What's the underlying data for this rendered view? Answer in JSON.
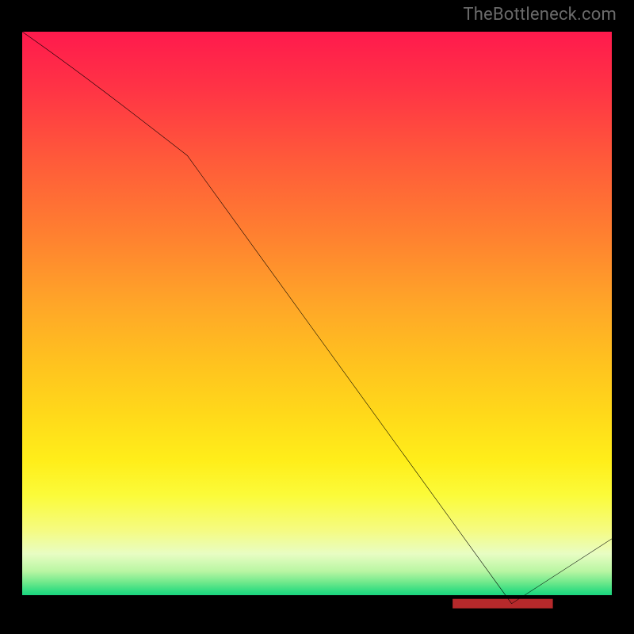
{
  "watermark": "TheBottleneck.com",
  "chart_data": {
    "type": "line",
    "title": "",
    "xlabel": "",
    "ylabel": "",
    "xlim": [
      0,
      100
    ],
    "ylim": [
      0,
      100
    ],
    "grid": false,
    "background_gradient": {
      "orientation": "vertical",
      "stops": [
        {
          "pct": 0,
          "color": "#ff1a4d"
        },
        {
          "pct": 22,
          "color": "#ff5a3a"
        },
        {
          "pct": 47,
          "color": "#ffa628"
        },
        {
          "pct": 66,
          "color": "#ffd91a"
        },
        {
          "pct": 86,
          "color": "#f5fb82"
        },
        {
          "pct": 95,
          "color": "#6de88b"
        },
        {
          "pct": 97.1,
          "color": "#1cd57f"
        },
        {
          "pct": 97.1,
          "color": "#000000"
        },
        {
          "pct": 100,
          "color": "#000000"
        }
      ]
    },
    "series": [
      {
        "name": "bottleneck-curve",
        "x": [
          0,
          28,
          83,
          100
        ],
        "y": [
          100,
          79,
          3,
          14
        ],
        "note": "piecewise: mild slope 0→28, steep linear 28→83 down to near zero at x≈83, then rises to ~14 at x=100"
      }
    ],
    "annotations": [
      {
        "name": "optimal-band",
        "shape": "rect",
        "x_range": [
          73,
          90
        ],
        "y": 3,
        "color": "#b6292b"
      }
    ]
  }
}
